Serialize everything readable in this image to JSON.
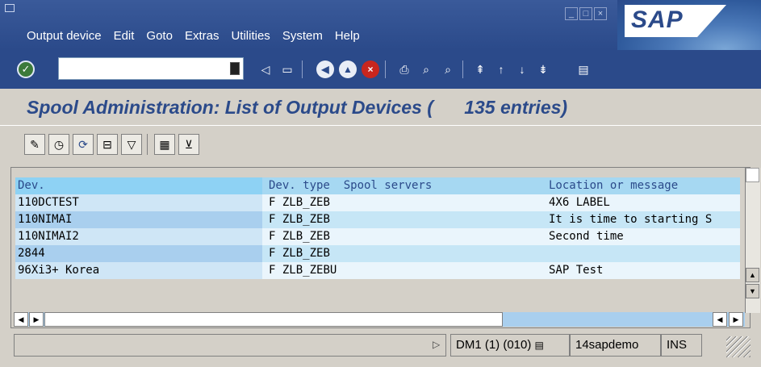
{
  "menu": {
    "items": [
      "Output device",
      "Edit",
      "Goto",
      "Extras",
      "Utilities",
      "System",
      "Help"
    ]
  },
  "window_buttons": [
    "minimize",
    "maximize",
    "close"
  ],
  "logo": {
    "text": "SAP"
  },
  "toolbar": {
    "command_value": "",
    "icons": [
      "enter-icon",
      "back-icon",
      "save-icon",
      "back-green-icon",
      "exit-icon",
      "cancel-icon",
      "print-icon",
      "find-icon",
      "find-next-icon",
      "first-page-icon",
      "prev-page-icon",
      "next-page-icon",
      "last-page-icon",
      "customize-icon"
    ]
  },
  "title": {
    "text": "Spool Administration: List of Output Devices (      135 entries)"
  },
  "app_toolbar": {
    "icons": [
      "change-icon",
      "execute-icon",
      "refresh-icon",
      "print-icon",
      "filter-icon",
      "detail-icon",
      "edit-icon"
    ]
  },
  "list": {
    "headers": {
      "dev": "Dev.",
      "type": "Dev. type",
      "servers": "Spool servers",
      "location": "Location or message"
    },
    "rows": [
      {
        "dev": "110DCTEST",
        "flag": "F",
        "type": "ZLB_ZEB",
        "servers": "",
        "location": "4X6 LABEL"
      },
      {
        "dev": "110NIMAI",
        "flag": "F",
        "type": "ZLB_ZEB",
        "servers": "",
        "location": "It is time to starting S"
      },
      {
        "dev": "110NIMAI2",
        "flag": "F",
        "type": "ZLB_ZEB",
        "servers": "",
        "location": "Second time"
      },
      {
        "dev": "2844",
        "flag": "F",
        "type": "ZLB_ZEB",
        "servers": "",
        "location": ""
      },
      {
        "dev": "96Xi3+ Korea",
        "flag": "F",
        "type": "ZLB_ZEBU",
        "servers": "",
        "location": "SAP Test"
      }
    ]
  },
  "status": {
    "message": "",
    "system": "DM1 (1) (010)",
    "server": "14sapdemo",
    "mode": "INS"
  },
  "colors": {
    "accent": "#2b4a8a",
    "header_row": "#a6d8f2",
    "even_row": "#eaf5fc",
    "odd_row": "#c6e6f6"
  }
}
